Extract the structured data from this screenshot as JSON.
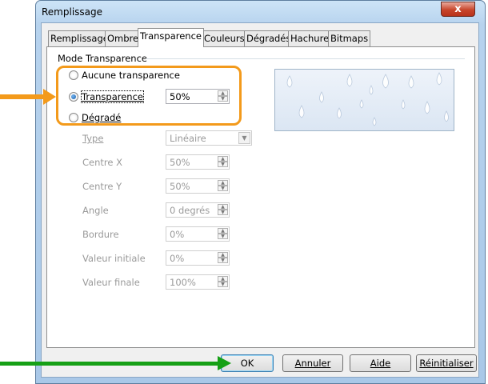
{
  "window": {
    "title": "Remplissage",
    "close_label": "x"
  },
  "tabs": [
    {
      "label": "Remplissage"
    },
    {
      "label": "Ombre"
    },
    {
      "label": "Transparence"
    },
    {
      "label": "Couleurs"
    },
    {
      "label": "Dégradés"
    },
    {
      "label": "Hachure"
    },
    {
      "label": "Bitmaps"
    }
  ],
  "active_tab": "Transparence",
  "group": {
    "label": "Mode Transparence"
  },
  "radios": [
    {
      "label": "Aucune transparence",
      "selected": false
    },
    {
      "label": "Transparence",
      "selected": true
    },
    {
      "label": "Dégradé",
      "selected": false
    }
  ],
  "transparency_value": "50%",
  "gradient": {
    "type_label": "Type",
    "type_value": "Linéaire",
    "fields": [
      {
        "label": "Centre X",
        "value": "50%"
      },
      {
        "label": "Centre Y",
        "value": "50%"
      },
      {
        "label": "Angle",
        "value": "0 degrés"
      },
      {
        "label": "Bordure",
        "value": "0%"
      },
      {
        "label": "Valeur initiale",
        "value": "0%"
      },
      {
        "label": "Valeur finale",
        "value": "100%"
      }
    ]
  },
  "buttons": {
    "ok": "OK",
    "cancel": "Annuler",
    "help": "Aide",
    "reset": "Réinitialiser"
  },
  "colors": {
    "highlight_orange": "#f39a1b",
    "arrow_green": "#16a016"
  }
}
